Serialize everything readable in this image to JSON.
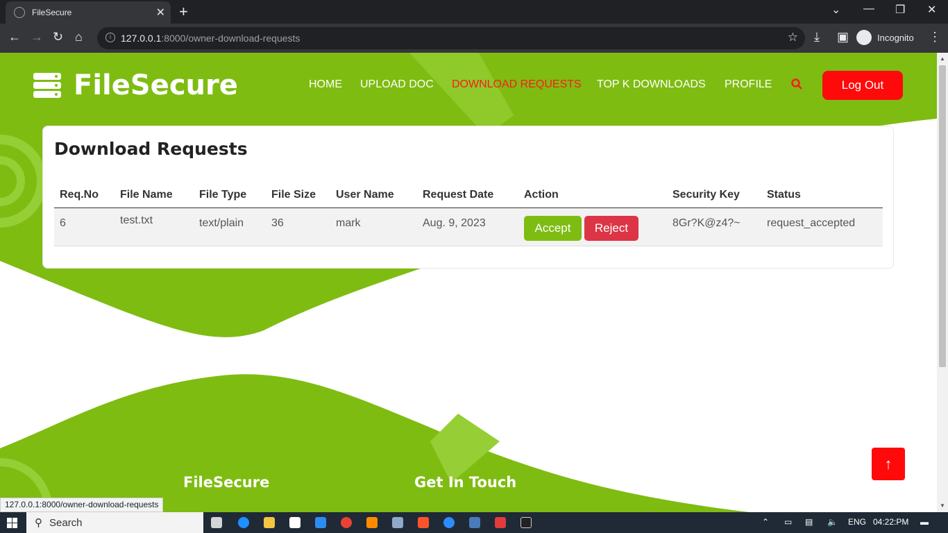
{
  "browser": {
    "tab_title": "FileSecure",
    "new_tab": "+",
    "url_host": "127.0.0.1",
    "url_path": ":8000/owner-download-requests",
    "incognito_label": "Incognito",
    "status_url": "127.0.0.1:8000/owner-download-requests"
  },
  "site": {
    "brand": "FileSecure",
    "nav": [
      "HOME",
      "UPLOAD DOC",
      "DOWNLOAD REQUESTS",
      "TOP K DOWNLOADS",
      "PROFILE"
    ],
    "logout_label": "Log Out"
  },
  "card": {
    "title": "Download Requests",
    "columns": [
      "Req.No",
      "File Name",
      "File Type",
      "File Size",
      "User Name",
      "Request Date",
      "Action",
      "Security Key",
      "Status"
    ],
    "rows": [
      {
        "req_no": "6",
        "file_name": "test.txt",
        "file_type": "text/plain",
        "file_size": "36",
        "user_name": "mark",
        "request_date": "Aug. 9, 2023",
        "accept_label": "Accept",
        "reject_label": "Reject",
        "security_key": "8Gr?K@z4?~",
        "status": "request_accepted"
      }
    ]
  },
  "footer": {
    "brand": "FileSecure",
    "get_in_touch": "Get In Touch"
  },
  "taskbar": {
    "search_label": "Search",
    "lang": "ENG",
    "time": "04:22:PM"
  },
  "colors": {
    "brand_green": "#7ebc12",
    "accent_red": "#ff0a0a",
    "reject_red": "#dc3545"
  }
}
